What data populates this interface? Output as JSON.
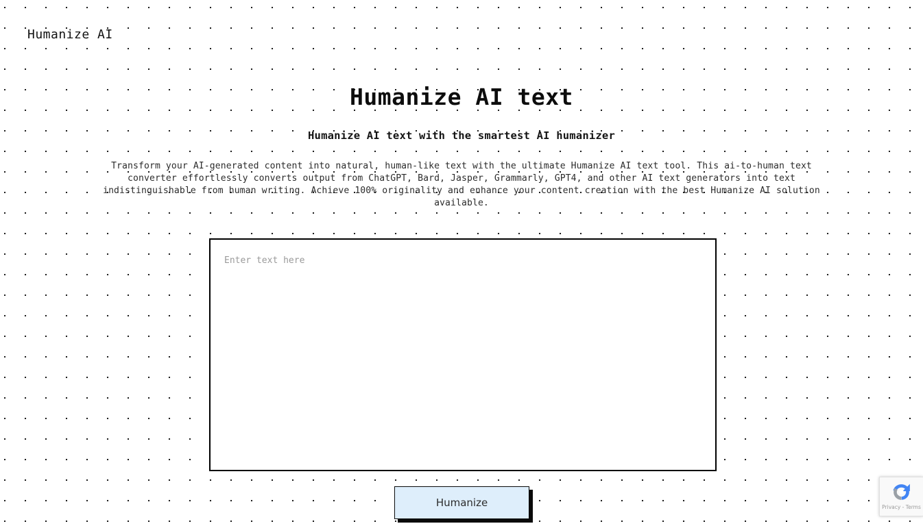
{
  "page": {
    "background_color": "#ffffff",
    "dot_color": "#111111",
    "dot_spacing_px": 30
  },
  "header": {
    "brand": "Humanize AI"
  },
  "hero": {
    "title": "Humanize AI text",
    "subtitle": "Humanize AI text with the smartest AI humanizer",
    "description": "Transform your AI-generated content into natural, human-like text with the ultimate Humanize AI text tool. This ai-to-human text converter effortlessly converts output from ChatGPT, Bard, Jasper, Grammarly, GPT4, and other AI text generators into text indistinguishable from human writing. Achieve 100% originality and enhance your content creation with the best Humanize AI solution available."
  },
  "editor": {
    "placeholder": "Enter text here",
    "value": "",
    "border_color": "#000000"
  },
  "actions": {
    "humanize_label": "Humanize",
    "humanize_fill": "#deeefb",
    "humanize_border": "#0a0a0a"
  },
  "recaptcha": {
    "links_label": "Privacy - Terms",
    "icon": "recaptcha-logo-icon"
  }
}
